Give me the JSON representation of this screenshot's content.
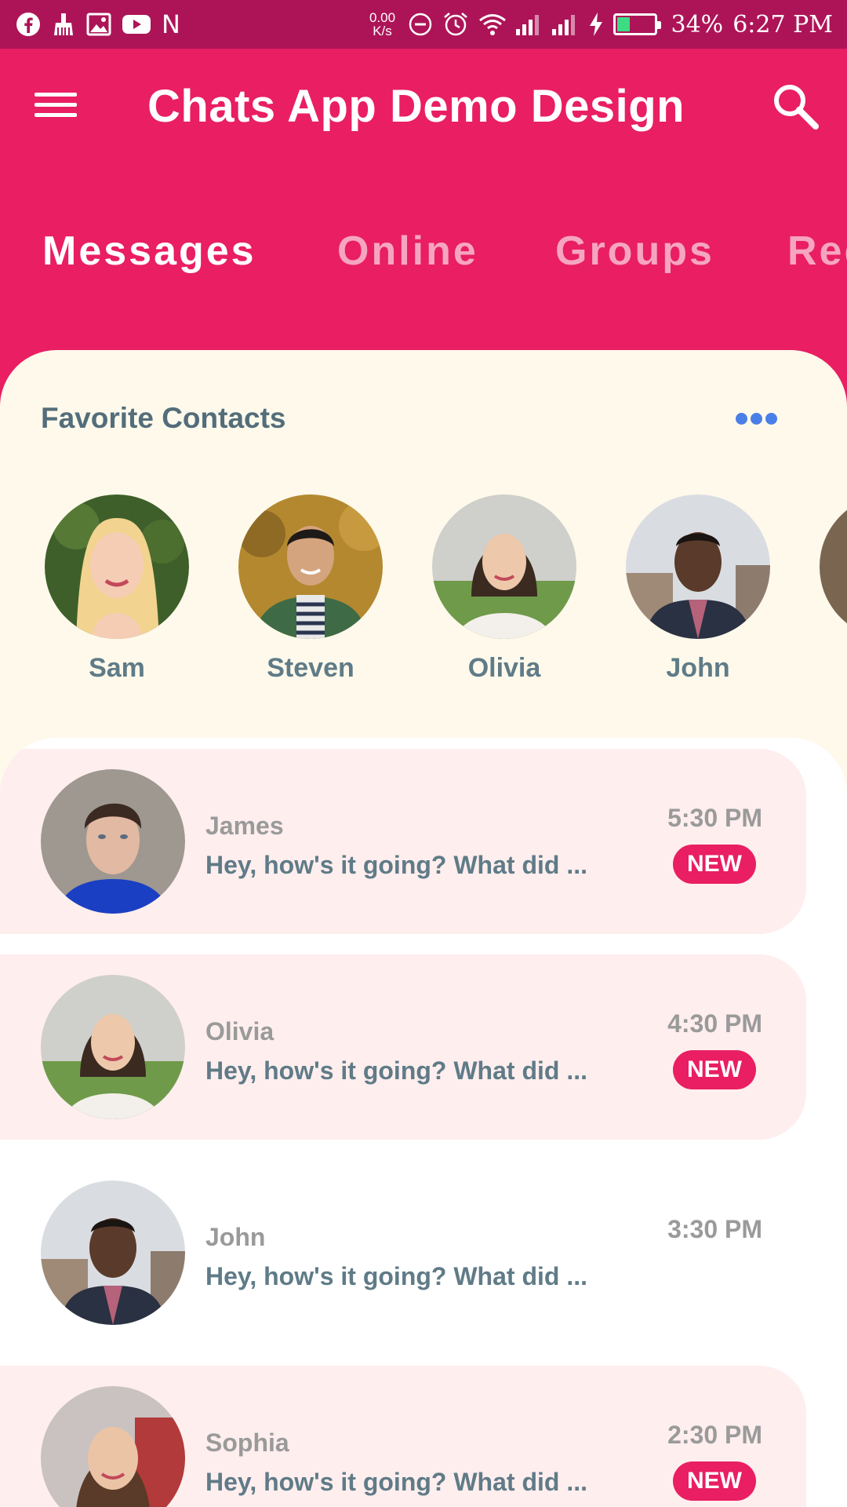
{
  "status_bar": {
    "icons": [
      "facebook-icon",
      "broom-icon",
      "image-icon",
      "youtube-icon",
      "n-icon"
    ],
    "n_glyph": "N",
    "net_speed_value": "0.00",
    "net_speed_unit": "K/s",
    "battery_level": 0.34,
    "battery_percent": "34%",
    "time": "6:27 PM"
  },
  "app_bar": {
    "title": "Chats App Demo Design",
    "background": "#E91E63"
  },
  "tabs": [
    {
      "label": "Messages",
      "active": true
    },
    {
      "label": "Online",
      "active": false
    },
    {
      "label": "Groups",
      "active": false
    },
    {
      "label": "Requests",
      "active": false
    }
  ],
  "favorites": {
    "header": "Favorite Contacts",
    "contacts": [
      {
        "name": "Sam"
      },
      {
        "name": "Steven"
      },
      {
        "name": "Olivia"
      },
      {
        "name": "John"
      },
      {
        "name": ""
      }
    ]
  },
  "chats": [
    {
      "name": "James",
      "message": "Hey, how's it going? What did ...",
      "time": "5:30 PM",
      "unread": true,
      "badge": "NEW"
    },
    {
      "name": "Olivia",
      "message": "Hey, how's it going? What did ...",
      "time": "4:30 PM",
      "unread": true,
      "badge": "NEW"
    },
    {
      "name": "John",
      "message": "Hey, how's it going? What did ...",
      "time": "3:30 PM",
      "unread": false,
      "badge": ""
    },
    {
      "name": "Sophia",
      "message": "Hey, how's it going? What did ...",
      "time": "2:30 PM",
      "unread": true,
      "badge": "NEW"
    }
  ],
  "colors": {
    "primary": "#E91E63",
    "status_bar": "#AD1457",
    "accent_dots": "#4A7FE8",
    "panel_bg": "#FEF9EB",
    "unread_row_bg": "#FFEEEE"
  }
}
